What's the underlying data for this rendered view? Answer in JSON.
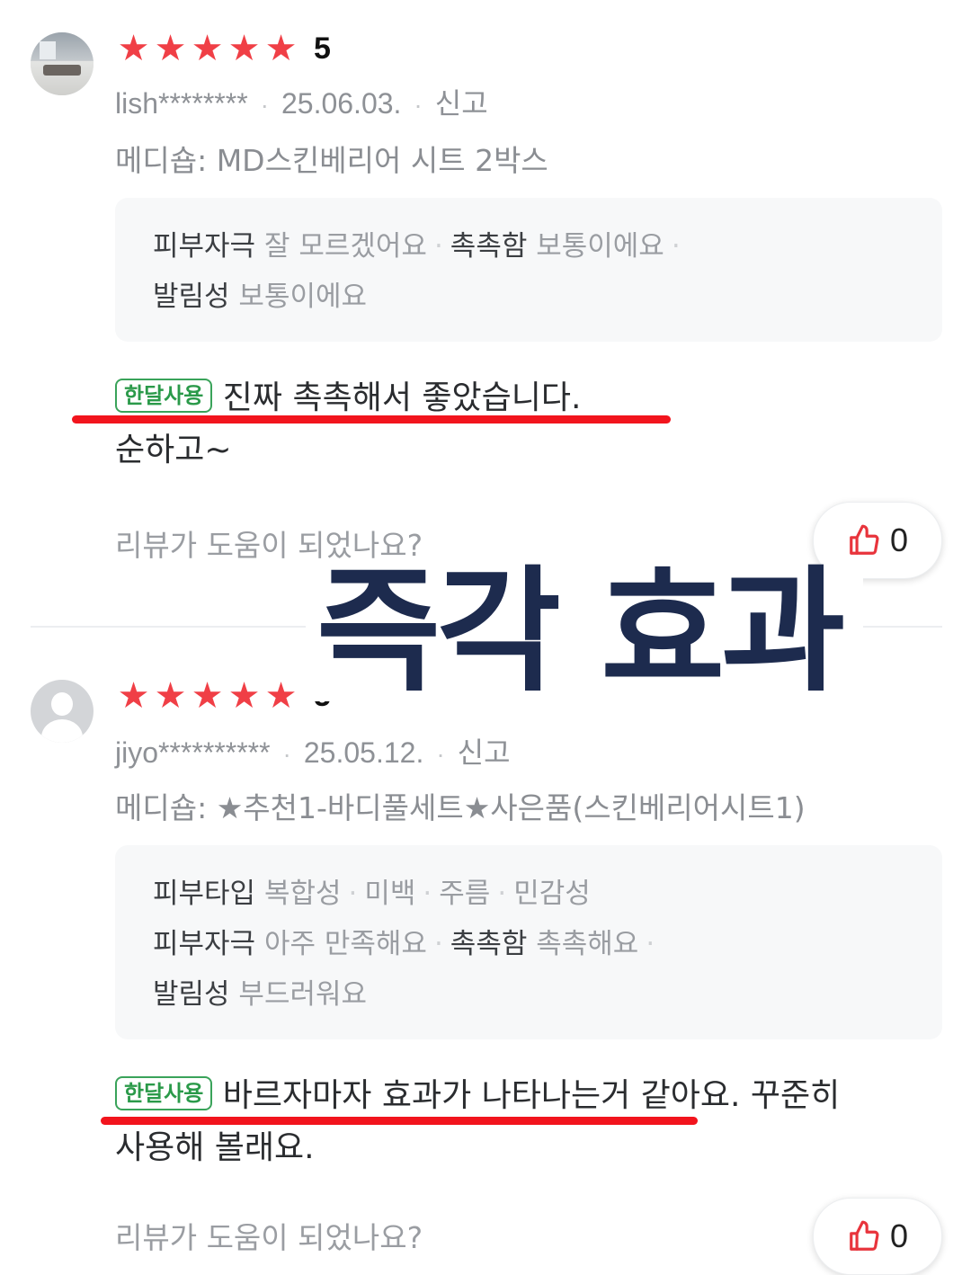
{
  "reviews": [
    {
      "rating_stars": 5,
      "score": "5",
      "user": "lish********",
      "date": "25.06.03.",
      "report": "신고",
      "option": "메디숍: MD스킨베리어 시트 2박스",
      "attrs": [
        [
          {
            "key": "피부자극",
            "value": "잘 모르겠어요"
          },
          {
            "key": "촉촉함",
            "value": "보통이에요"
          }
        ],
        [
          {
            "key": "발림성",
            "value": "보통이에요"
          }
        ]
      ],
      "badge": "한달사용",
      "text_line1": "진짜 촉촉해서 좋았습니다.",
      "text_line2": "순하고~",
      "helpful_question": "리뷰가 도움이 되었나요?",
      "like_count": "0"
    },
    {
      "rating_stars": 5,
      "score": "5",
      "user": "jiyo**********",
      "date": "25.05.12.",
      "report": "신고",
      "option": "메디숍: ★추천1-바디풀세트★사은품(스킨베리어시트1)",
      "attrs": [
        [
          {
            "key": "피부타입",
            "value": "복합성"
          },
          {
            "key": "",
            "value": "미백"
          },
          {
            "key": "",
            "value": "주름"
          },
          {
            "key": "",
            "value": "민감성"
          }
        ],
        [
          {
            "key": "피부자극",
            "value": "아주 만족해요"
          },
          {
            "key": "촉촉함",
            "value": "촉촉해요"
          }
        ],
        [
          {
            "key": "발림성",
            "value": "부드러워요"
          }
        ]
      ],
      "badge": "한달사용",
      "text_line1": "바르자마자 효과가 나타나는거 같아요. 꾸준히",
      "text_line2": "사용해 볼래요.",
      "helpful_question": "리뷰가 도움이 되었나요?",
      "like_count": "0"
    }
  ],
  "overlay_caption": "즉각 효과",
  "colors": {
    "star": "#f03f46",
    "badge_green": "#2b9a4a",
    "underline_red": "#f2141d",
    "caption_navy": "#1d2b4e",
    "like_icon_red": "#e8343c"
  },
  "icons": {
    "star": "star-icon",
    "like": "thumbs-up-icon"
  }
}
